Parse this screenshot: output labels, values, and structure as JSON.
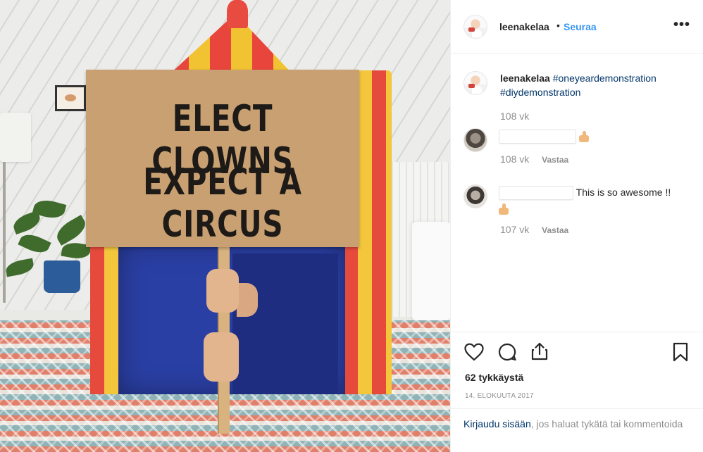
{
  "post": {
    "sign": {
      "line1": "ELECT CLOWNS",
      "line2": "EXPECT A CIRCUS"
    }
  },
  "header": {
    "username": "leenakelaa",
    "separator": "•",
    "follow_label": "Seuraa",
    "more_label": "•••"
  },
  "caption": {
    "username": "leenakelaa",
    "hashtag1": "#oneyeardemonstration",
    "hashtag2": "#diydemonstration",
    "time": "108 vk"
  },
  "comments": [
    {
      "text": "",
      "emoji": "thumbs-up",
      "time": "108 vk",
      "reply_label": "Vastaa"
    },
    {
      "text": "This is so awesome !!",
      "emoji": "thumbs-up",
      "time": "107 vk",
      "reply_label": "Vastaa"
    }
  ],
  "actions": {
    "icons": [
      "heart-icon",
      "comment-icon",
      "share-icon",
      "bookmark-icon"
    ]
  },
  "likes": "62 tykkäystä",
  "date": "14. ELOKUUTA 2017",
  "login": {
    "link": "Kirjaudu sisään",
    "rest": ", jos haluat tykätä tai kommentoida"
  },
  "colors": {
    "link_blue": "#3897f0",
    "hashtag_blue": "#003569",
    "muted": "#8e8e8e"
  }
}
